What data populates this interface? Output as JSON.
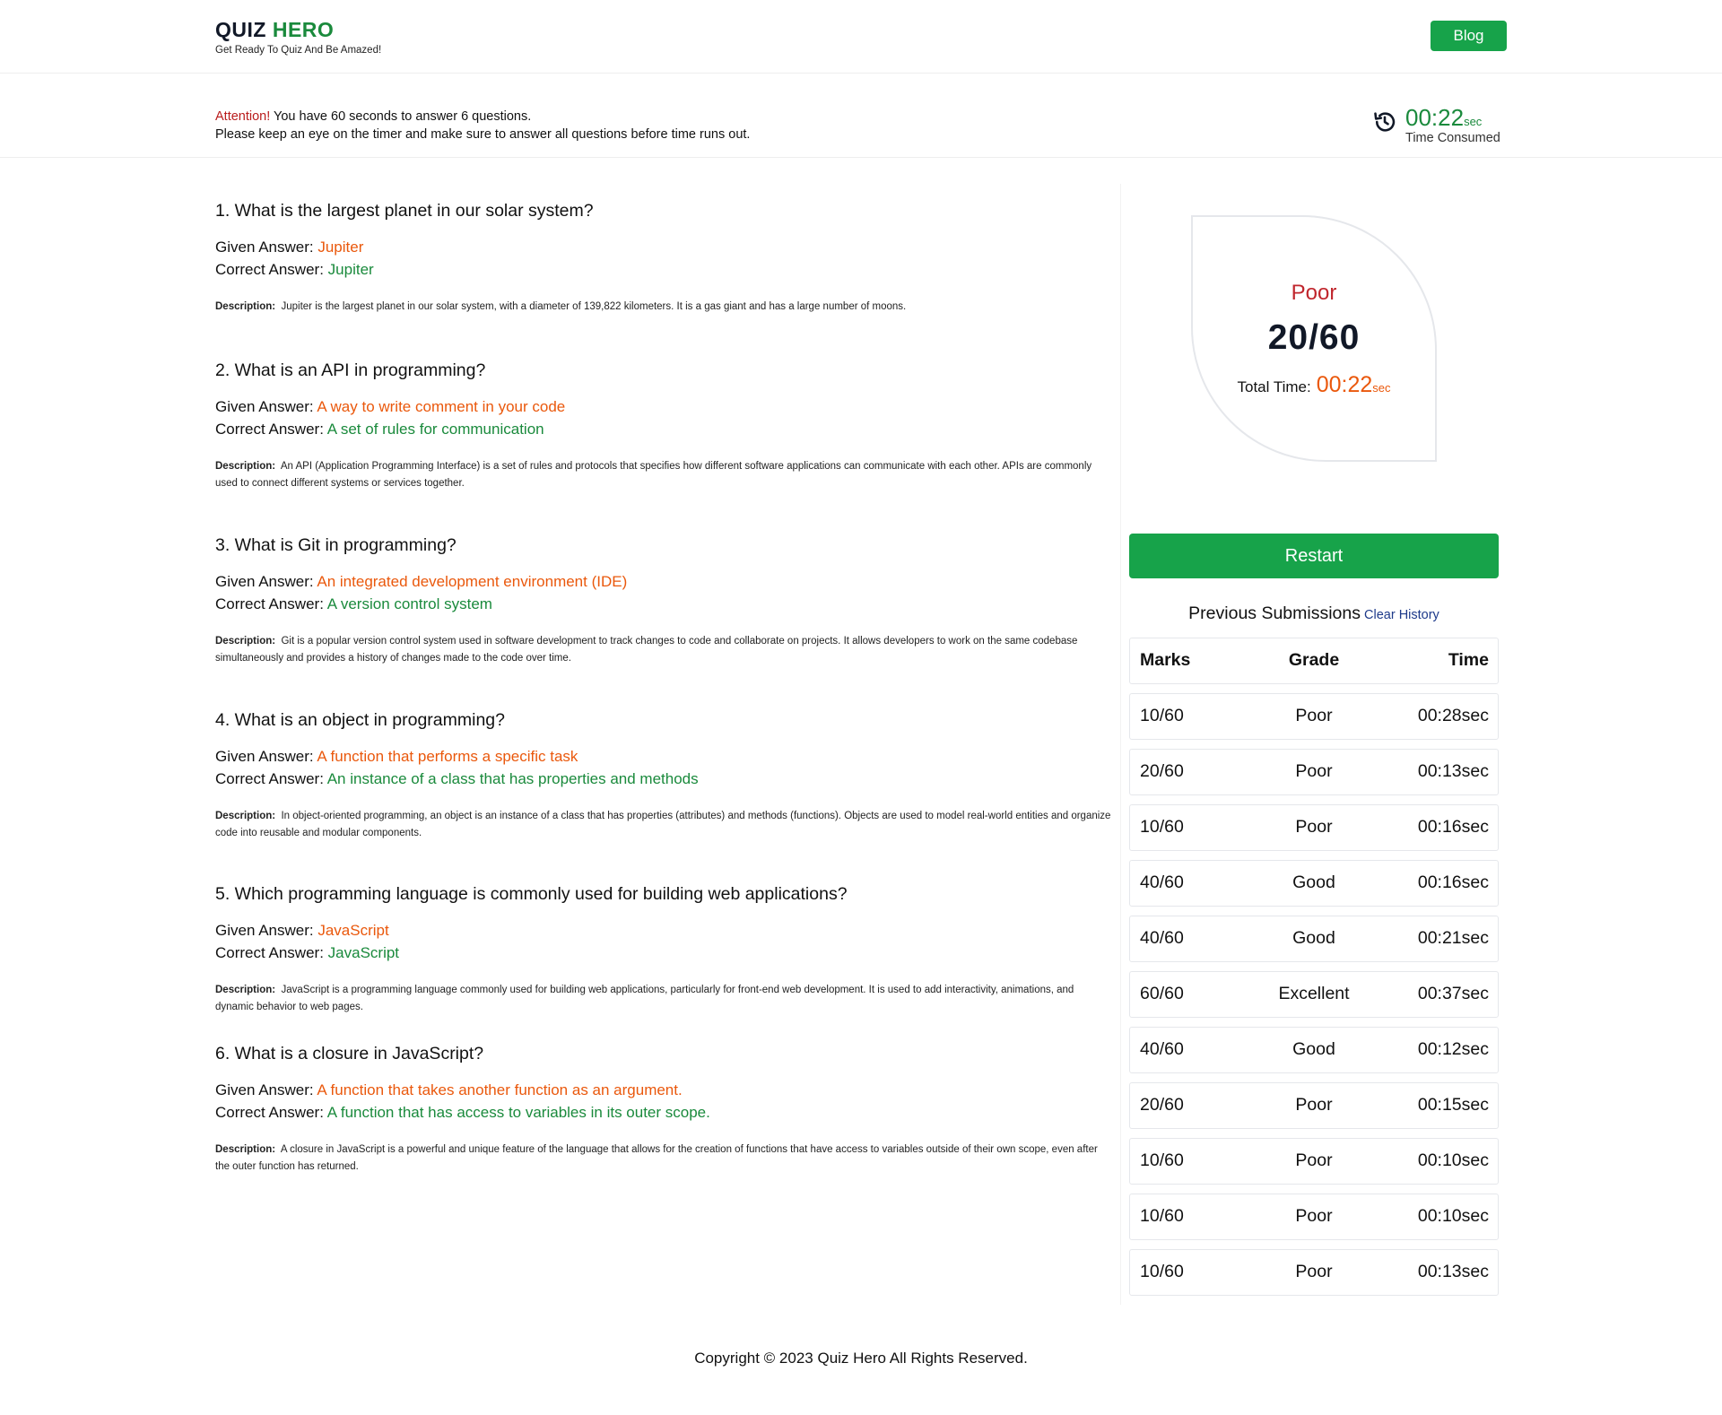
{
  "header": {
    "logo_word1": "QUIZ",
    "logo_word2": "HERO",
    "tagline": "Get Ready To Quiz And Be Amazed!",
    "blog_label": "Blog"
  },
  "notice": {
    "attention_label": "Attention!",
    "line1": " You have 60 seconds to answer 6 questions.",
    "line2": "Please keep an eye on the timer and make sure to answer all questions before time runs out.",
    "timer_value": "00:22",
    "timer_unit": "sec",
    "timer_label": "Time Consumed"
  },
  "labels": {
    "given": "Given Answer: ",
    "correct": "Correct Answer: ",
    "description": "Description:"
  },
  "questions": [
    {
      "title": "1. What is the largest planet in our solar system?",
      "given": "Jupiter",
      "correct": "Jupiter",
      "description": "Jupiter is the largest planet in our solar system, with a diameter of 139,822 kilometers. It is a gas giant and has a large number of moons."
    },
    {
      "title": "2. What is an API in programming?",
      "given": "A way to write comment in your code",
      "correct": "A set of rules for communication",
      "description": "An API (Application Programming Interface) is a set of rules and protocols that specifies how different software applications can communicate with each other. APIs are commonly used to connect different systems or services together."
    },
    {
      "title": "3. What is Git in programming?",
      "given": "An integrated development environment (IDE)",
      "correct": "A version control system",
      "description": "Git is a popular version control system used in software development to track changes to code and collaborate on projects. It allows developers to work on the same codebase simultaneously and provides a history of changes made to the code over time."
    },
    {
      "title": "4. What is an object in programming?",
      "given": "A function that performs a specific task",
      "correct": "An instance of a class that has properties and methods",
      "description": "In object-oriented programming, an object is an instance of a class that has properties (attributes) and methods (functions). Objects are used to model real-world entities and organize code into reusable and modular components."
    },
    {
      "title": "5. Which programming language is commonly used for building web applications?",
      "given": "JavaScript",
      "correct": "JavaScript",
      "description": "JavaScript is a programming language commonly used for building web applications, particularly for front-end web development. It is used to add interactivity, animations, and dynamic behavior to web pages."
    },
    {
      "title": "6. What is a closure in JavaScript?",
      "given": "A function that takes another function as an argument.",
      "correct": "A function that has access to variables in its outer scope.",
      "description": "A closure in JavaScript is a powerful and unique feature of the language that allows for the creation of functions that have access to variables outside of their own scope, even after the outer function has returned."
    }
  ],
  "result": {
    "grade": "Poor",
    "score": "20/60",
    "total_time_label": "Total Time:",
    "total_time_value": "00:22",
    "total_time_unit": "sec",
    "restart_label": "Restart"
  },
  "history": {
    "title": "Previous Submissions",
    "clear_label": "Clear History",
    "headers": [
      "Marks",
      "Grade",
      "Time"
    ],
    "rows": [
      {
        "marks": "10/60",
        "grade": "Poor",
        "time": "00:28sec"
      },
      {
        "marks": "20/60",
        "grade": "Poor",
        "time": "00:13sec"
      },
      {
        "marks": "10/60",
        "grade": "Poor",
        "time": "00:16sec"
      },
      {
        "marks": "40/60",
        "grade": "Good",
        "time": "00:16sec"
      },
      {
        "marks": "40/60",
        "grade": "Good",
        "time": "00:21sec"
      },
      {
        "marks": "60/60",
        "grade": "Excellent",
        "time": "00:37sec"
      },
      {
        "marks": "40/60",
        "grade": "Good",
        "time": "00:12sec"
      },
      {
        "marks": "20/60",
        "grade": "Poor",
        "time": "00:15sec"
      },
      {
        "marks": "10/60",
        "grade": "Poor",
        "time": "00:10sec"
      },
      {
        "marks": "10/60",
        "grade": "Poor",
        "time": "00:10sec"
      },
      {
        "marks": "10/60",
        "grade": "Poor",
        "time": "00:13sec"
      }
    ]
  },
  "footer": {
    "copyright": "Copyright © 2023 Quiz Hero All Rights Reserved."
  },
  "colors": {
    "brand_green": "#1a8a3c",
    "button_green": "#17a34a",
    "wrong_orange": "#ea580c",
    "poor_red": "#c0262d",
    "link_blue": "#1e3a8a"
  },
  "icons": {
    "timer": "history-clock-icon"
  }
}
